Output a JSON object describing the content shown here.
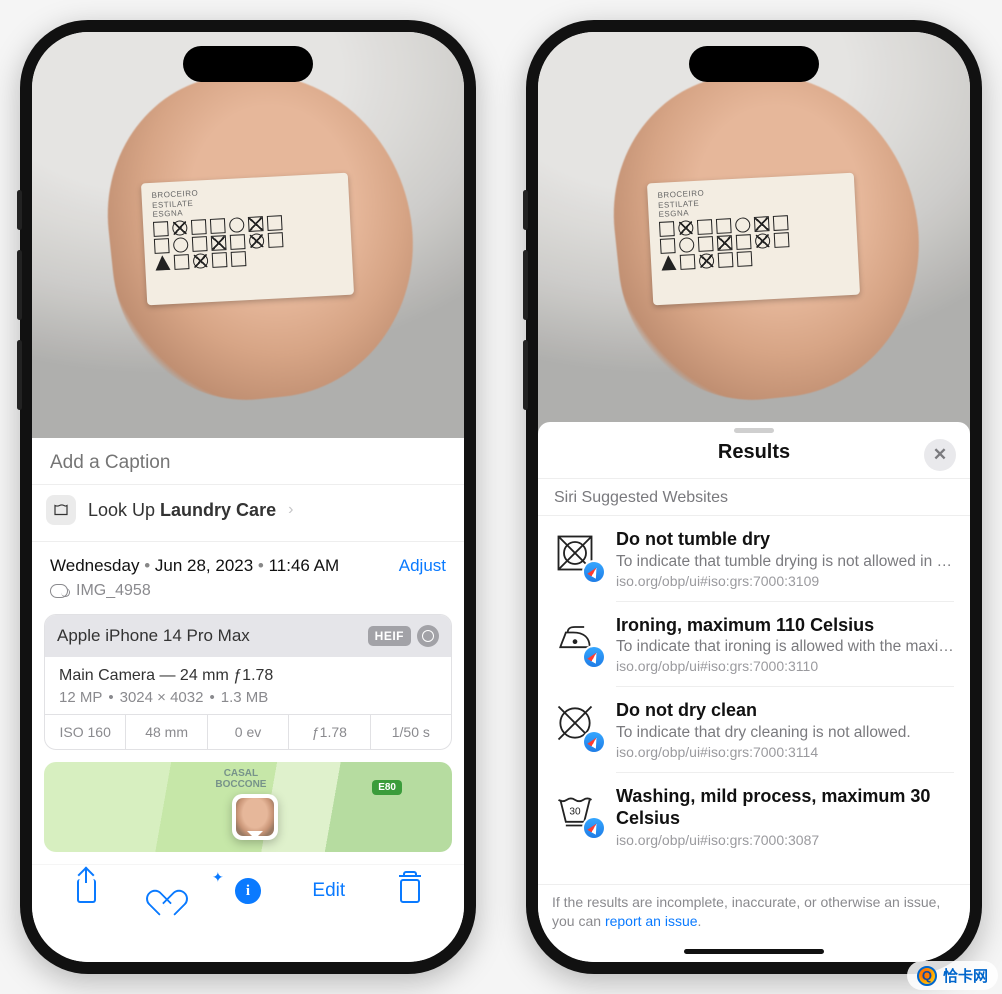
{
  "phoneA": {
    "caption_placeholder": "Add a Caption",
    "lookup": {
      "prefix": "Look Up ",
      "term": "Laundry Care"
    },
    "datetime": {
      "weekday": "Wednesday",
      "date": "Jun 28, 2023",
      "time": "11:46 AM"
    },
    "adjust_label": "Adjust",
    "filename": "IMG_4958",
    "exif": {
      "device": "Apple iPhone 14 Pro Max",
      "format_badge": "HEIF",
      "lens": "Main Camera — 24 mm ƒ1.78",
      "mp": "12 MP",
      "dimensions": "3024 × 4032",
      "filesize": "1.3 MB",
      "cells": [
        "ISO 160",
        "48 mm",
        "0 ev",
        "ƒ1.78",
        "1/50 s"
      ]
    },
    "map": {
      "area_label": "CASAL\nBOCCONE",
      "road": "E80"
    },
    "toolbar": {
      "edit_label": "Edit"
    }
  },
  "phoneB": {
    "sheet_title": "Results",
    "section": "Siri Suggested Websites",
    "results": [
      {
        "title": "Do not tumble dry",
        "desc": "To indicate that tumble drying is not allowed in the…",
        "url": "iso.org/obp/ui#iso:grs:7000:3109",
        "icon": "no-tumble-dry"
      },
      {
        "title": "Ironing, maximum 110 Celsius",
        "desc": "To indicate that ironing is allowed with the maximu…",
        "url": "iso.org/obp/ui#iso:grs:7000:3110",
        "icon": "iron-110"
      },
      {
        "title": "Do not dry clean",
        "desc": "To indicate that dry cleaning is not allowed.",
        "url": "iso.org/obp/ui#iso:grs:7000:3114",
        "icon": "no-dry-clean"
      },
      {
        "title": "Washing, mild process, maximum 30 Celsius",
        "desc": "",
        "url": "iso.org/obp/ui#iso:grs:7000:3087",
        "icon": "wash-30"
      }
    ],
    "footer": {
      "text_before": "If the results are incomplete, inaccurate, or otherwise an issue, you can ",
      "link": "report an issue",
      "text_after": "."
    }
  },
  "watermark": "恰卡网"
}
